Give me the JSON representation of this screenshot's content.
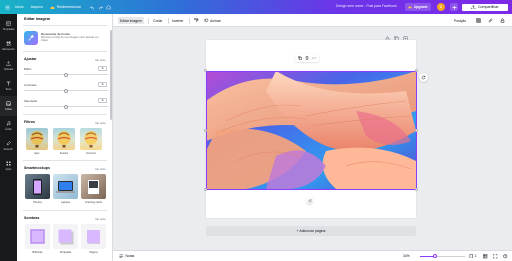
{
  "topbar": {
    "home_label": "Início",
    "file_label": "Arquivo",
    "resize_label": "Redimensionar",
    "doc_title": "Design sem nome - Post para Facebook",
    "upgrade_label": "Upgrade",
    "avatar_initial": "C",
    "share_label": "Compartilhar"
  },
  "rail": {
    "items": [
      {
        "label": "Templates",
        "icon": "templates-icon"
      },
      {
        "label": "Elementos",
        "icon": "elements-icon"
      },
      {
        "label": "Uploads",
        "icon": "upload-icon"
      },
      {
        "label": "Texto",
        "icon": "text-icon"
      },
      {
        "label": "Fotos",
        "icon": "photos-icon"
      },
      {
        "label": "Áudio",
        "icon": "audio-icon"
      },
      {
        "label": "Desenh.",
        "icon": "draw-icon"
      },
      {
        "label": "Apps",
        "icon": "apps-icon"
      }
    ],
    "active_index": 4
  },
  "panel": {
    "title": "Editar imagem",
    "bg_remover": {
      "title": "Removedor de Fundo",
      "desc": "Remova o fundo de uma imagem com apenas um clique."
    },
    "adjust": {
      "title": "Ajustar",
      "see_all": "Ver tudo",
      "sliders": [
        {
          "label": "Brilho",
          "value": "0",
          "level": 0.5
        },
        {
          "label": "Contraste",
          "value": "0",
          "level": 0.5
        },
        {
          "label": "Saturação",
          "value": "0",
          "level": 0.5
        }
      ]
    },
    "filters": {
      "title": "Filtros",
      "see_all": "Ver tudo",
      "items": [
        "Epic",
        "Festive",
        "Summer"
      ]
    },
    "smartmockups": {
      "title": "Smartmockups",
      "see_all": "Ver tudo",
      "items": [
        "Phones",
        "Laptops",
        "Greeting cards"
      ]
    },
    "shadows": {
      "title": "Sombras",
      "see_all": "Ver tudo",
      "items": [
        "Brilhante",
        "Projetada",
        "Página"
      ]
    }
  },
  "context_toolbar": {
    "edit_image": "Editar imagem",
    "crop": "Cortar",
    "flip": "Inverter",
    "animate": "Animar",
    "position": "Posição"
  },
  "canvas": {
    "add_page": "+ Adicionar página"
  },
  "bottombar": {
    "notes": "Notas",
    "zoom": "34%",
    "zoom_level": 0.34,
    "page_count": "1"
  },
  "colors": {
    "accent": "#8b3dff",
    "rail_bg": "#18191b"
  }
}
